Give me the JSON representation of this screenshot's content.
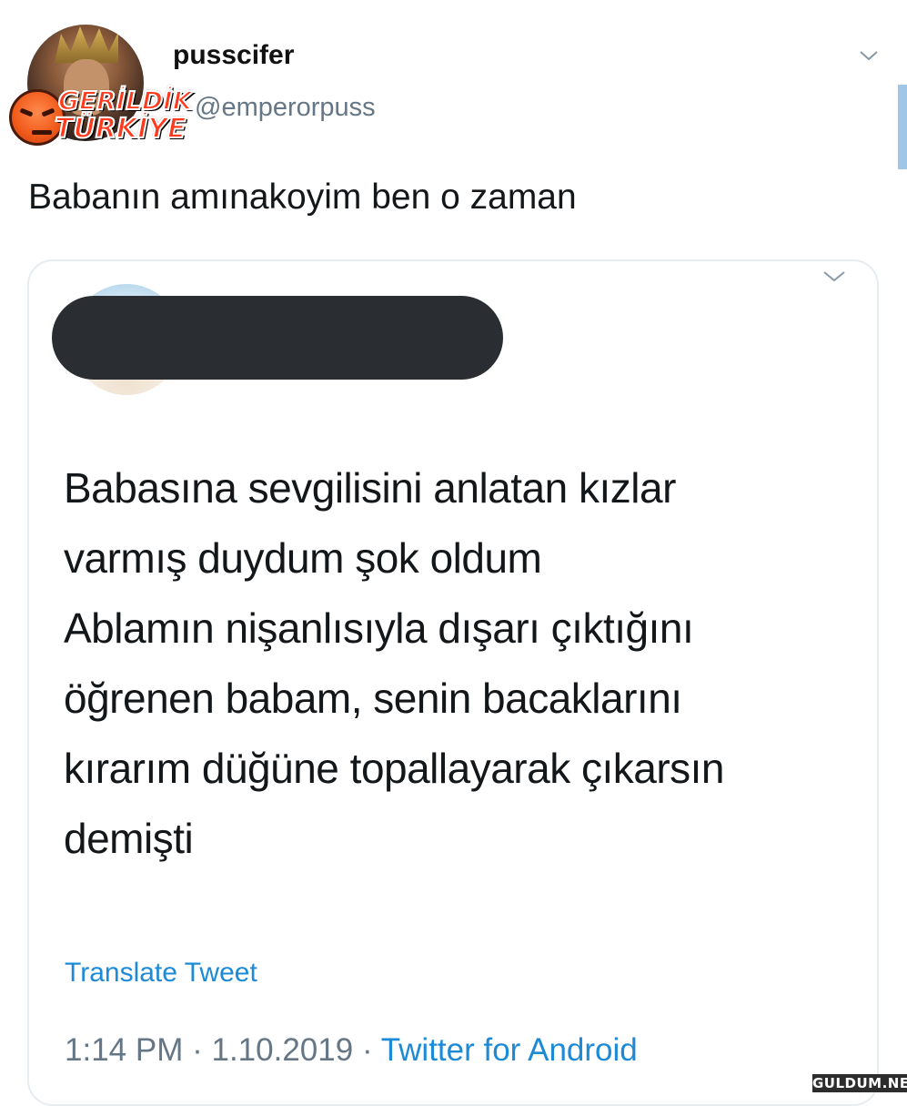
{
  "tweet": {
    "username": "pusscifer",
    "handle": "@emperorpuss",
    "text": "Babanın amınakoyim ben o zaman"
  },
  "overlay_logo": {
    "line1": "GERİLDİK",
    "line2": "TÜRKİYE"
  },
  "quoted_tweet": {
    "lines": [
      "Babasına sevgilisini anlatan kızlar",
      "varmış duydum şok oldum",
      "Ablamın nişanlısıyla dışarı çıktığını",
      "öğrenen babam, senin bacaklarını",
      "kırarım düğüne topallayarak çıkarsın",
      "demişti"
    ],
    "translate_label": "Translate Tweet",
    "time": "1:14 PM",
    "date": "1.10.2019",
    "separator": "·",
    "source": "Twitter for Android"
  },
  "watermark": "GULDUM.NET",
  "colors": {
    "link_blue": "#1d8ad6",
    "secondary_text": "#657786",
    "primary_text": "#14171a",
    "card_border": "#e6ecf0"
  },
  "icons": {
    "chevron": "chevron-down-icon",
    "angry_face": "angry-face-icon"
  }
}
